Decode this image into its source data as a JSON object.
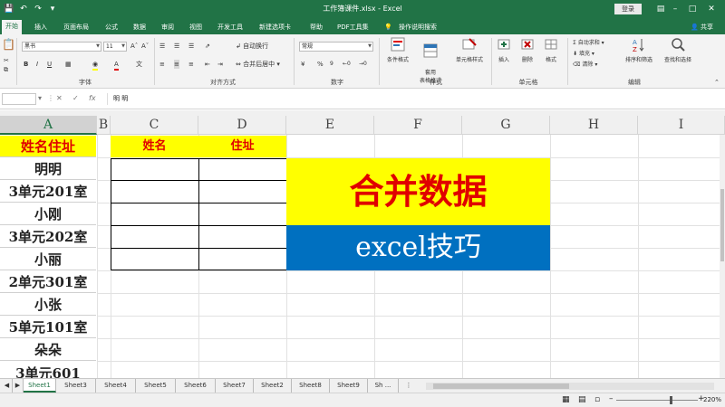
{
  "window": {
    "title": "工作簿课件.xlsx  -  Excel",
    "login_label": "登录"
  },
  "ribbon_tabs": [
    "开始",
    "插入",
    "页面布局",
    "公式",
    "数据",
    "审阅",
    "视图",
    "开发工具",
    "新建选项卡",
    "帮助",
    "PDF工具集",
    "操作说明搜索"
  ],
  "share_label": "共享",
  "ribbon": {
    "font_name": "黑书",
    "font_size": "11",
    "number_format": "常规",
    "wrap_text": "自动换行",
    "merge_center": "合并后居中",
    "conditional_format": "条件格式",
    "table_format": "套用\n表格格式",
    "cell_style": "单元格样式",
    "insert": "插入",
    "delete": "删除",
    "format": "格式",
    "autosum": "自动求和",
    "fill": "填充",
    "clear": "清除",
    "sort_filter": "排序和筛选",
    "find_select": "查找和选择",
    "groups": [
      "字体",
      "对齐方式",
      "数字",
      "样式",
      "单元格",
      "编辑"
    ]
  },
  "formula_bar": {
    "content": "明 明"
  },
  "sheet": {
    "columns": [
      "A",
      "B",
      "C",
      "D",
      "E",
      "F",
      "G",
      "H",
      "I"
    ],
    "a_column_values": [
      "姓名住址",
      "明明",
      "3单元201室",
      "小刚",
      "3单元202室",
      "小丽",
      "2单元301室",
      "小张",
      "5单元101室",
      "朵朵",
      "3单元601"
    ],
    "table_headers": [
      "姓名",
      "住址"
    ],
    "banner_title": "合并数据",
    "banner_subtitle": "excel技巧"
  },
  "sheet_tabs": [
    "Sheet1",
    "Sheet3",
    "Sheet4",
    "Sheet5",
    "Sheet6",
    "Sheet7",
    "Sheet2",
    "Sheet8",
    "Sheet9",
    "Sh ..."
  ],
  "status": {
    "zoom": "220%"
  },
  "colors": {
    "excel_green": "#217346",
    "header_yellow": "#ffff00",
    "header_red": "#e00000",
    "banner_blue": "#0070c0"
  }
}
